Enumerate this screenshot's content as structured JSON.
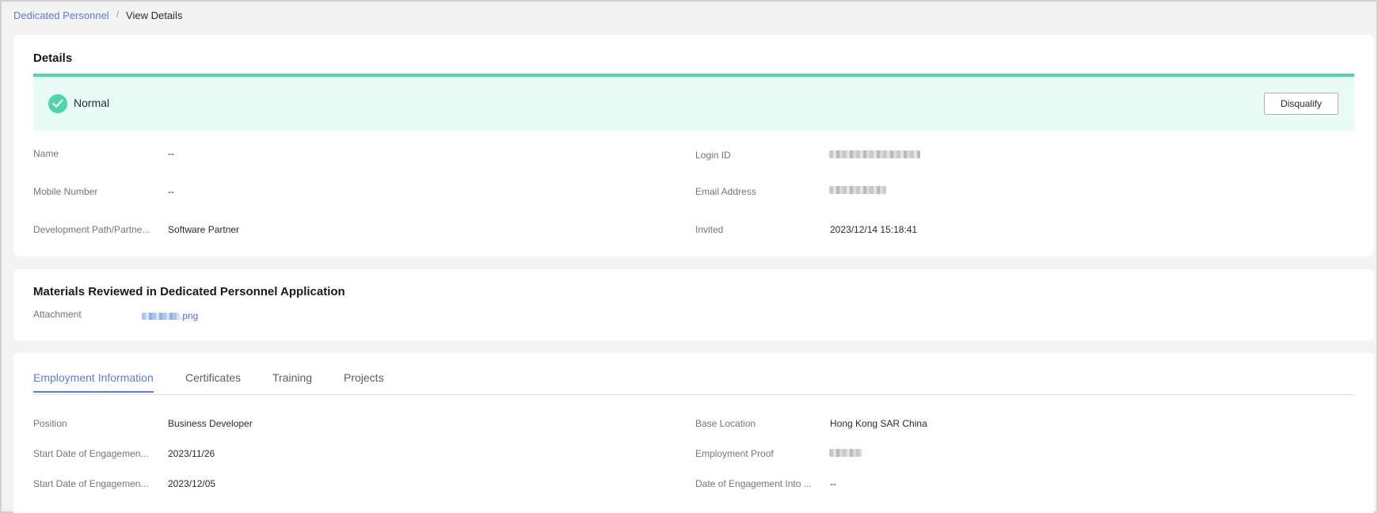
{
  "breadcrumb": {
    "parent": "Dedicated Personnel",
    "separator": "/",
    "current": "View Details"
  },
  "details": {
    "title": "Details",
    "status": "Normal",
    "disqualify_label": "Disqualify",
    "fields": {
      "name_label": "Name",
      "name_value": "--",
      "mobile_label": "Mobile Number",
      "mobile_value": "--",
      "devpath_label": "Development Path/Partne...",
      "devpath_value": "Software Partner",
      "login_label": "Login ID",
      "email_label": "Email Address",
      "invited_label": "Invited",
      "invited_value": "2023/12/14 15:18:41"
    }
  },
  "materials": {
    "title": "Materials Reviewed in Dedicated Personnel Application",
    "attachment_label": "Attachment",
    "attachment_ext": ".png"
  },
  "employment": {
    "tabs": [
      "Employment Information",
      "Certificates",
      "Training",
      "Projects"
    ],
    "active_tab": "Employment Information",
    "fields": {
      "position_label": "Position",
      "position_value": "Business Developer",
      "start1_label": "Start Date of Engagemen...",
      "start1_value": "2023/11/26",
      "start2_label": "Start Date of Engagemen...",
      "start2_value": "2023/12/05",
      "base_label": "Base Location",
      "base_value": "Hong Kong SAR China",
      "proof_label": "Employment Proof",
      "into_label": "Date of Engagement Into ...",
      "into_value": "--"
    }
  },
  "colors": {
    "accent": "#5e7ce0",
    "status_green": "#50d4ab",
    "status_bg": "#e8fbf4"
  },
  "icons": {
    "status": "check-circle-icon"
  }
}
